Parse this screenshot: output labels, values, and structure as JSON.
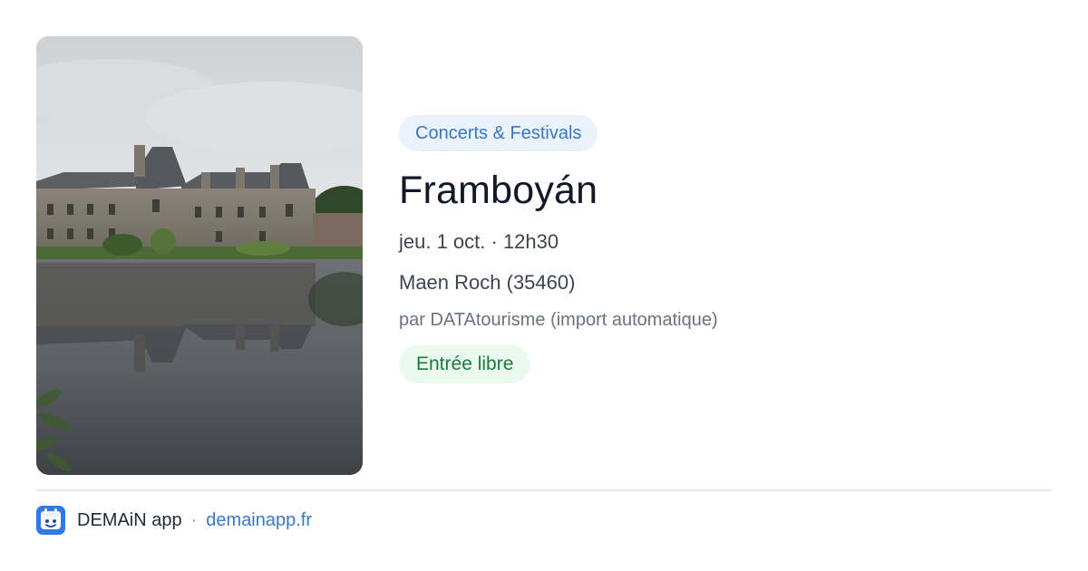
{
  "event": {
    "category": "Concerts & Festivals",
    "title": "Framboyán",
    "datetime": "jeu. 1 oct. · 12h30",
    "location": "Maen Roch (35460)",
    "source": "par DATAtourisme (import automatique)",
    "price": "Entrée libre",
    "image_subject": "château reflected in pond"
  },
  "footer": {
    "app_name": "DEMAiN app",
    "separator": "·",
    "link": "demainapp.fr"
  },
  "colors": {
    "accent_blue": "#3a78c7",
    "category_badge_bg": "#eaf2fc",
    "price_green": "#1e7a3c",
    "price_badge_bg": "#eafaef",
    "title_text": "#111827",
    "body_text": "#3d4451",
    "muted_text": "#6b7280"
  },
  "icons": {
    "app_logo": "demain-app-logo-icon"
  }
}
